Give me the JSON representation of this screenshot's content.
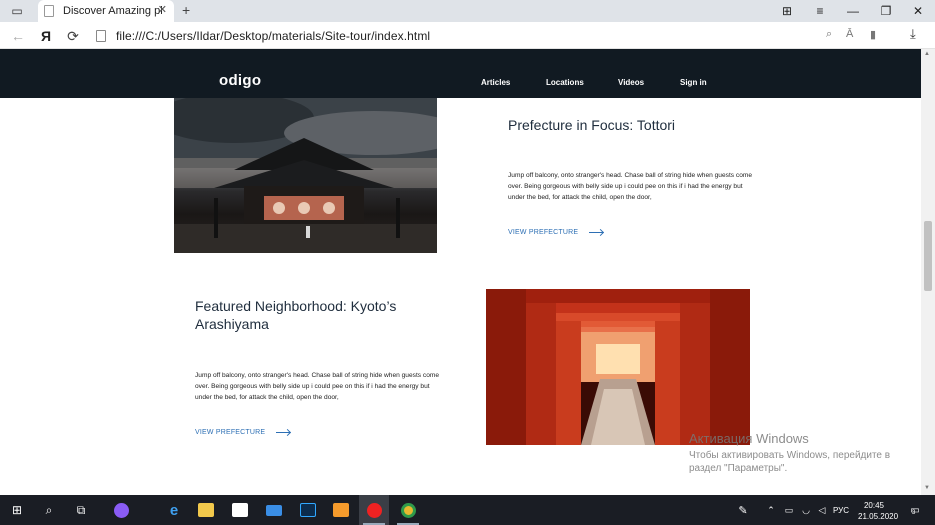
{
  "browser": {
    "tab_title": "Discover Amazing places",
    "tab_close": "✕",
    "new_tab": "+",
    "url": "file:///C:/Users/Ildar/Desktop/materials/Site-tour/index.html"
  },
  "site": {
    "logo": "odigo",
    "nav": [
      "Articles",
      "Locations",
      "Videos",
      "Sign in"
    ]
  },
  "sections": [
    {
      "title": "Prefecture in Focus: Tottori",
      "body": "Jump off balcony, onto stranger's head. Chase ball of string hide when guests come over. Being gorgeous with belly side up i could pee on this if i had the energy but under the bed, for attack the child, open the door,",
      "link": "VIEW PREFECTURE"
    },
    {
      "title_line1": "Featured Neighborhood: Kyoto’s",
      "title_line2": "Arashiyama",
      "body": "Jump off balcony, onto stranger's head. Chase ball of string hide when guests come over. Being gorgeous with belly side up i could pee on this if i had the energy but under the bed, for attack the child, open the door,",
      "link": "VIEW PREFECTURE"
    }
  ],
  "watermark": {
    "title": "Активация Windows",
    "subtitle": "Чтобы активировать Windows, перейдите в раздел \"Параметры\"."
  },
  "taskbar": {
    "lang": "РУС",
    "time": "20:45",
    "date": "21.05.2020",
    "notification_count": "3"
  },
  "colors": {
    "header_bg": "#111a22",
    "link": "#2d6fb4",
    "title": "#1f2d3d",
    "taskbar_bg": "#1a1d24"
  }
}
